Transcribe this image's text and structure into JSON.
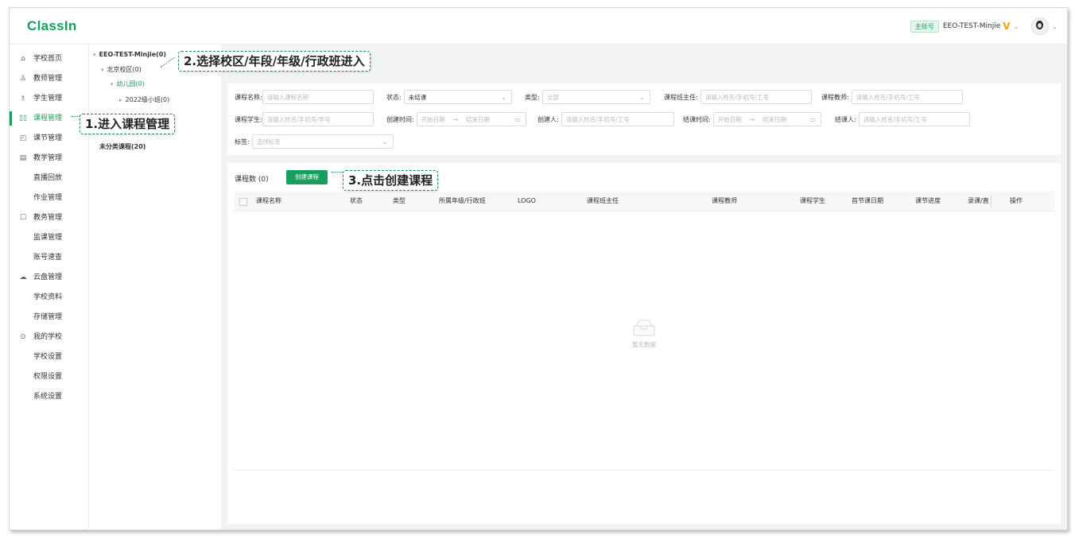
{
  "app": {
    "logo": "ClassIn"
  },
  "header": {
    "role_badge": "主账号",
    "account_name": "EEO-TEST-Minjie",
    "vip_mark": "V",
    "chevron": "⌄"
  },
  "sidebar": {
    "items": [
      {
        "label": "学校首页",
        "icon": "home-icon"
      },
      {
        "label": "教师管理",
        "icon": "user-icon"
      },
      {
        "label": "学生管理",
        "icon": "users-icon"
      },
      {
        "label": "课程管理",
        "icon": "book-icon",
        "active": true
      },
      {
        "label": "课节管理",
        "icon": "lesson-icon"
      },
      {
        "label": "教学管理",
        "icon": "teaching-icon"
      },
      {
        "label": "直播回放"
      },
      {
        "label": "作业管理"
      },
      {
        "label": "教务管理",
        "icon": "edu-icon"
      },
      {
        "label": "监课管理"
      },
      {
        "label": "账号速查"
      },
      {
        "label": "云盘管理",
        "icon": "cloud-icon"
      },
      {
        "label": "学校资料"
      },
      {
        "label": "存储管理"
      },
      {
        "label": "我的学校",
        "icon": "school-icon"
      },
      {
        "label": "学校设置"
      },
      {
        "label": "权限设置"
      },
      {
        "label": "系统设置"
      }
    ]
  },
  "tree": {
    "root": "EEO-TEST-Minjie(0)",
    "campus": "北京校区(0)",
    "grade": "幼儿园(0)",
    "class": "2022级小班(0)",
    "uncategorized": "未分类课程(20)"
  },
  "filters": {
    "course_name_label": "课程名称:",
    "course_name_placeholder": "请输入课程名称",
    "status_label": "状态:",
    "status_value": "未结课",
    "type_label": "类型:",
    "type_value": "全部",
    "head_teacher_label": "课程班主任:",
    "head_teacher_placeholder": "请输入姓名/手机号/工号",
    "teacher_label": "课程教师:",
    "teacher_placeholder": "请输入姓名/手机号/工号",
    "student_label": "课程学生:",
    "student_placeholder": "请输入姓名/手机号/学号",
    "created_time_label": "创建时间:",
    "start_placeholder": "开始日期",
    "end_placeholder": "结束日期",
    "creator_label": "创建人:",
    "creator_placeholder": "请输入姓名/手机号/工号",
    "closed_time_label": "结课时间:",
    "closer_label": "结课人:",
    "closer_placeholder": "请输入姓名/手机号/工号",
    "tag_label": "标签:",
    "tag_placeholder": "选择标签",
    "range_arrow": "→"
  },
  "list": {
    "count_label": "课程数 (0)",
    "create_button": "创建课程",
    "columns": [
      "课程名称",
      "状态",
      "类型",
      "所属年级/行政班",
      "LOGO",
      "课程班主任",
      "课程教师",
      "课程学生",
      "首节课日期",
      "课节进度",
      "录课/直",
      "操作"
    ],
    "empty_text": "暂无数据"
  },
  "callouts": {
    "step1": "1.进入课程管理",
    "step2": "2.选择校区/年段/年级/行政班进入",
    "step3": "3.点击创建课程"
  }
}
